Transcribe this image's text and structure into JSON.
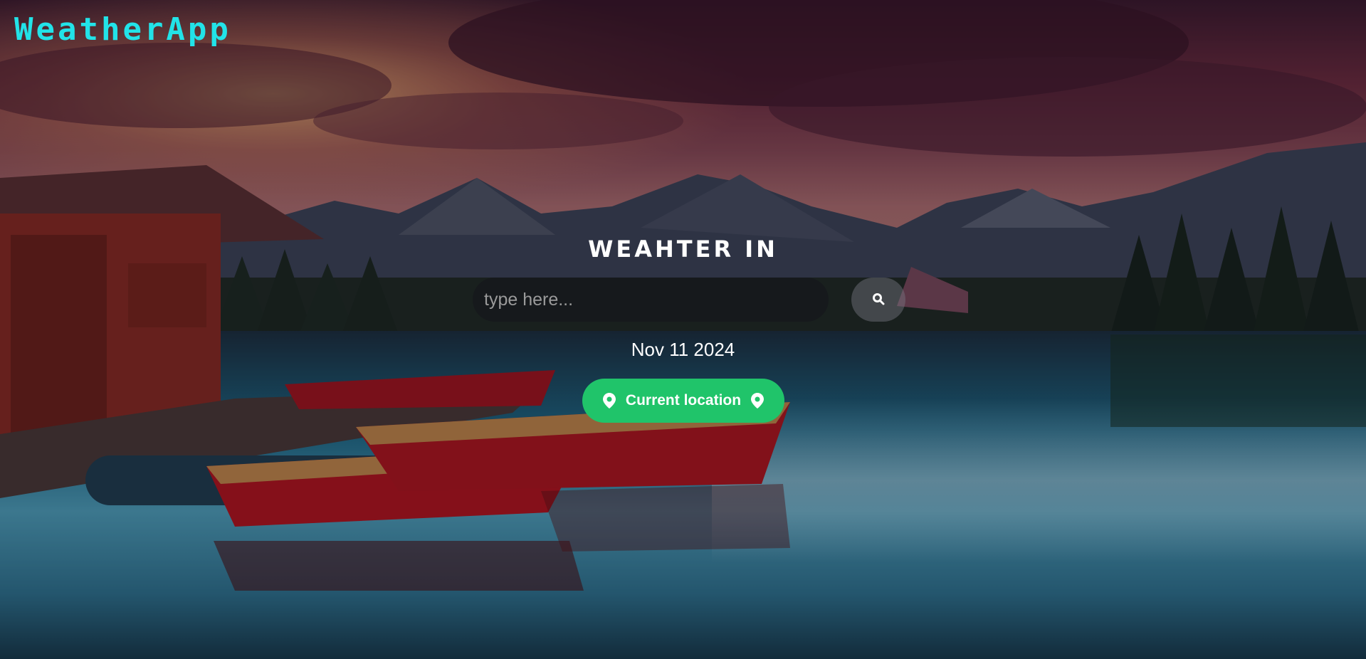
{
  "brand": {
    "title": "WeatherApp"
  },
  "main": {
    "heading": "WEAHTER IN",
    "search": {
      "placeholder": "type here...",
      "value": "",
      "icon": "search-icon"
    },
    "date": "Nov 11 2024",
    "current_location": {
      "label": "Current location",
      "icon": "map-pin-icon"
    }
  },
  "colors": {
    "brand": "#22e3e8",
    "accent": "#20c46a",
    "text": "#ffffff"
  }
}
